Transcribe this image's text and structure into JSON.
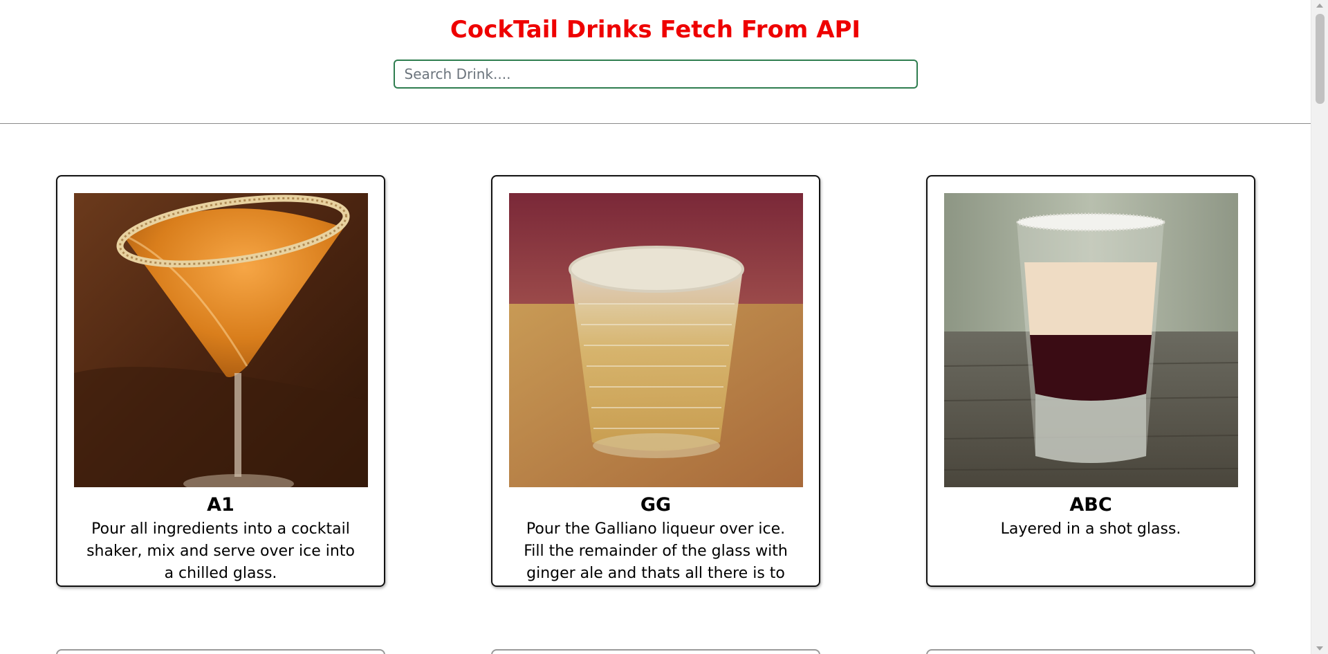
{
  "header": {
    "title": "CockTail Drinks Fetch From API",
    "search_placeholder": "Search Drink....",
    "search_value": ""
  },
  "drinks": [
    {
      "name": "A1",
      "instructions": "Pour all ingredients into a cocktail shaker, mix and serve over ice into a chilled glass.",
      "image": "orange-martini-sugar-rim"
    },
    {
      "name": "GG",
      "instructions": "Pour the Galliano liqueur over ice. Fill the remainder of the glass with ginger ale and thats all there is to it. You now",
      "image": "textured-tumbler-over-ice"
    },
    {
      "name": "ABC",
      "instructions": "Layered in a shot glass.",
      "image": "layered-shot-glass"
    }
  ],
  "colors": {
    "title": "#ee0000",
    "search_border": "#2e7d4f",
    "card_border": "#111111"
  }
}
